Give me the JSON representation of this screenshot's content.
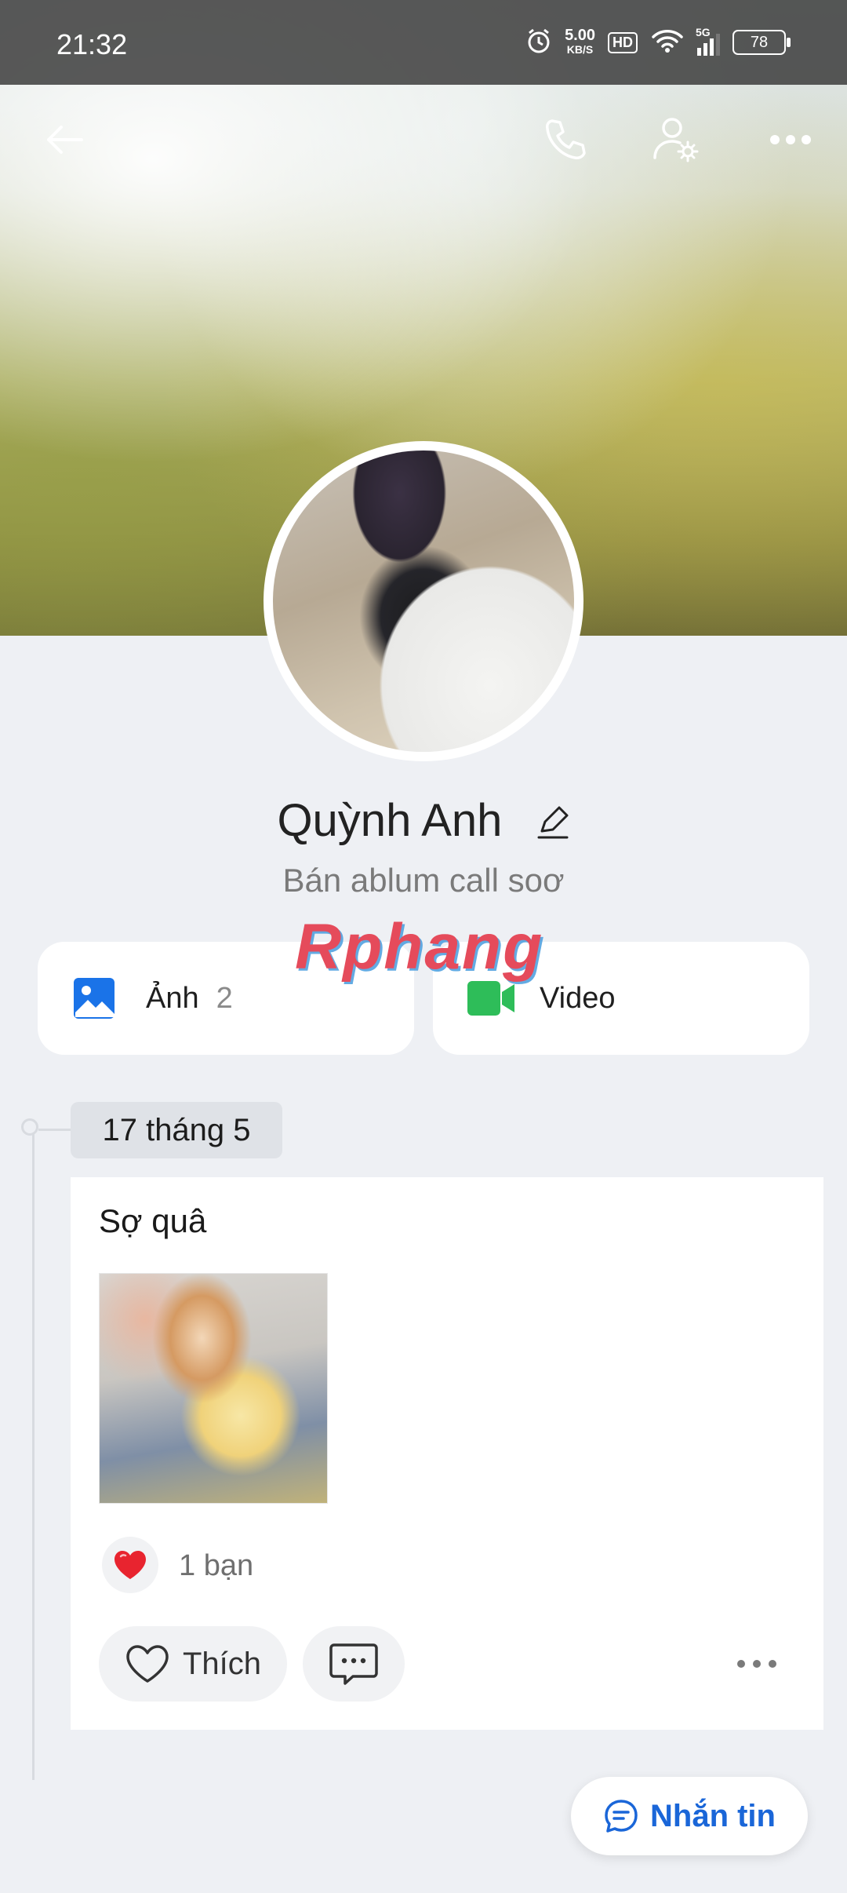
{
  "status_bar": {
    "time": "21:32",
    "net_speed": "5.00",
    "net_unit": "KB/S",
    "hd": "HD",
    "network": "5G",
    "battery": "78"
  },
  "header": {
    "icons": [
      "back-arrow-icon",
      "phone-icon",
      "user-settings-icon",
      "more-icon"
    ]
  },
  "profile": {
    "name": "Quỳnh Anh",
    "bio": "Bán ablum call soơ"
  },
  "watermark": "Rphang",
  "media": {
    "photos_label": "Ảnh",
    "photos_count": "2",
    "video_label": "Video",
    "photos_icon_color": "#1a73e8",
    "video_icon_color": "#2ebd59"
  },
  "timeline": {
    "date": "17 tháng 5",
    "post": {
      "text": "Sợ quâ",
      "reaction_count": "1 bạn",
      "like_label": "Thích"
    }
  },
  "message_button": {
    "label": "Nhắn tin",
    "color": "#1a66d8"
  }
}
